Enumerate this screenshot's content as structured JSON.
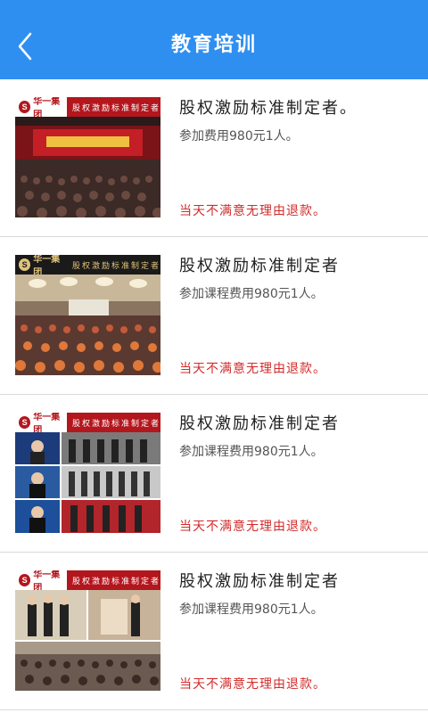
{
  "header": {
    "title": "教育培训",
    "background_color": "#2f8ff0",
    "back_icon": "chevron-left-icon"
  },
  "thumb_common": {
    "logo_text": "华一集团",
    "banner_text": "股权激励标准制定者"
  },
  "items": [
    {
      "title": "股权激励标准制定者。",
      "subtitle": "参加费用980元1人。",
      "note": "当天不满意无理由退款。",
      "thumb_style": "red"
    },
    {
      "title": "股权激励标准制定者",
      "subtitle": "参加课程费用980元1人。",
      "note": "当天不满意无理由退款。",
      "thumb_style": "dark"
    },
    {
      "title": "股权激励标准制定者",
      "subtitle": "参加课程费用980元1人。",
      "note": "当天不满意无理由退款。",
      "thumb_style": "red"
    },
    {
      "title": "股权激励标准制定者",
      "subtitle": "参加课程费用980元1人。",
      "note": "当天不满意无理由退款。",
      "thumb_style": "red"
    }
  ],
  "colors": {
    "accent": "#2f8ff0",
    "note_red": "#d22b2b",
    "banner_red": "#b3161d"
  }
}
